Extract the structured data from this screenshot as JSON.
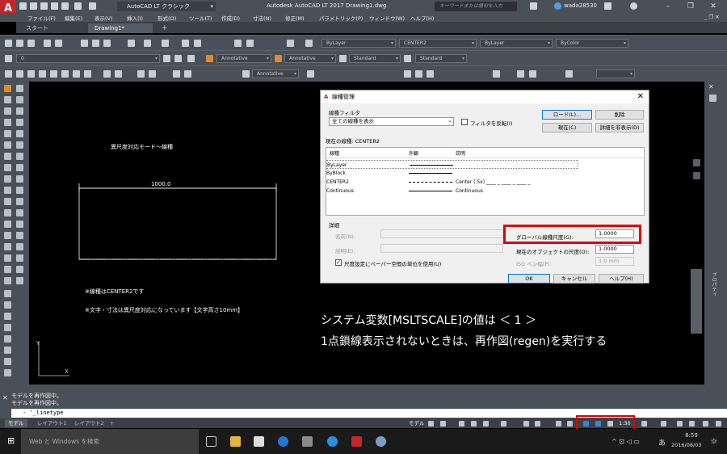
{
  "title_bar": {
    "workspace": "AutoCAD LT クラシック",
    "window_title": "Autodesk AutoCAD LT 2017    Drawing1.dwg",
    "search_placeholder": "キーワードまたは語句を入力",
    "user": "wada28530",
    "app_logo_sub": "LT"
  },
  "menu": [
    "ファイル(F)",
    "編集(E)",
    "表示(V)",
    "挿入(I)",
    "形式(O)",
    "ツール(T)",
    "作成(D)",
    "寸法(N)",
    "修正(M)",
    "パラメトリック(P)",
    "ウィンドウ(W)",
    "ヘルプ(H)"
  ],
  "tabs": {
    "start": "スタート",
    "drawing": "Drawing1*",
    "add": "+"
  },
  "toolbar": {
    "layer": "ByLayer",
    "linetype": "CENTER2",
    "lineweight": "ByLayer",
    "color": "ByColor",
    "layer_name": "0",
    "annot1": "Annotative",
    "annot2": "Annotative",
    "style1": "Standard",
    "style2": "Standard",
    "annot3": "Annotative"
  },
  "drawing": {
    "heading": "異尺度対応モード〜線種",
    "dimension": "1000.0",
    "note1": "※線種はCENTER2です",
    "note2": "※文字・寸法は異尺度対応になっています【文字高さ10mm】",
    "msg1": "システム変数[MSLTSCALE]の値は  ＜ 1 ＞",
    "msg2": "1点鎖線表示されないときは、再作図(regen)を実行する",
    "ucs_x": "X",
    "ucs_y": "Y"
  },
  "dialog": {
    "title": "線種管理",
    "filter_label": "線種フィルタ",
    "filter_value": "全ての線種を表示",
    "invert_label": "フィルタを反転(I)",
    "load_btn": "ロード(L)...",
    "delete_btn": "削除",
    "current_btn": "現在(C)",
    "hide_details_btn": "詳細を非表示(D)",
    "current_linetype": "現在の線種:  CENTER2",
    "col_linetype": "線種",
    "col_appearance": "外観",
    "col_description": "説明",
    "rows": [
      {
        "name": "ByLayer",
        "appearance": "solid",
        "desc": ""
      },
      {
        "name": "ByBlock",
        "appearance": "solid",
        "desc": ""
      },
      {
        "name": "CENTER2",
        "appearance": "dash",
        "desc": "Center (.5x) ____ _ ____ _ ____ _"
      },
      {
        "name": "Continuous",
        "appearance": "solid",
        "desc": "Continuous"
      }
    ],
    "details_label": "詳細",
    "name_label": "名前(N):",
    "desc_label": "説明(E):",
    "paper_scale_label": "尺度設定にペーパー空間の単位を使用(U)",
    "global_scale_label": "グローバル線種尺度(G):",
    "global_scale_value": "1.0000",
    "current_scale_label": "現在のオブジェクトの尺度(O):",
    "current_scale_value": "1.0000",
    "iso_pen_label": "ISO ペン幅(P):",
    "iso_pen_value": "1.0 mm",
    "ok_btn": "OK",
    "cancel_btn": "キャンセル",
    "help_btn": "ヘルプ(H)"
  },
  "command": {
    "history1": "モデルを再作図中。",
    "history2": "モデルを再作図中。",
    "input": "- '_linetype"
  },
  "layout_tabs": [
    "モデル",
    "レイアウト1",
    "レイアウト2",
    "+"
  ],
  "status": {
    "model": "モデル",
    "scale": "1:30"
  },
  "taskbar": {
    "search": "Web と Windows を検索",
    "time": "8:59",
    "date": "2016/06/03",
    "ime": "あ"
  },
  "right_panel_label": "プロパティ"
}
